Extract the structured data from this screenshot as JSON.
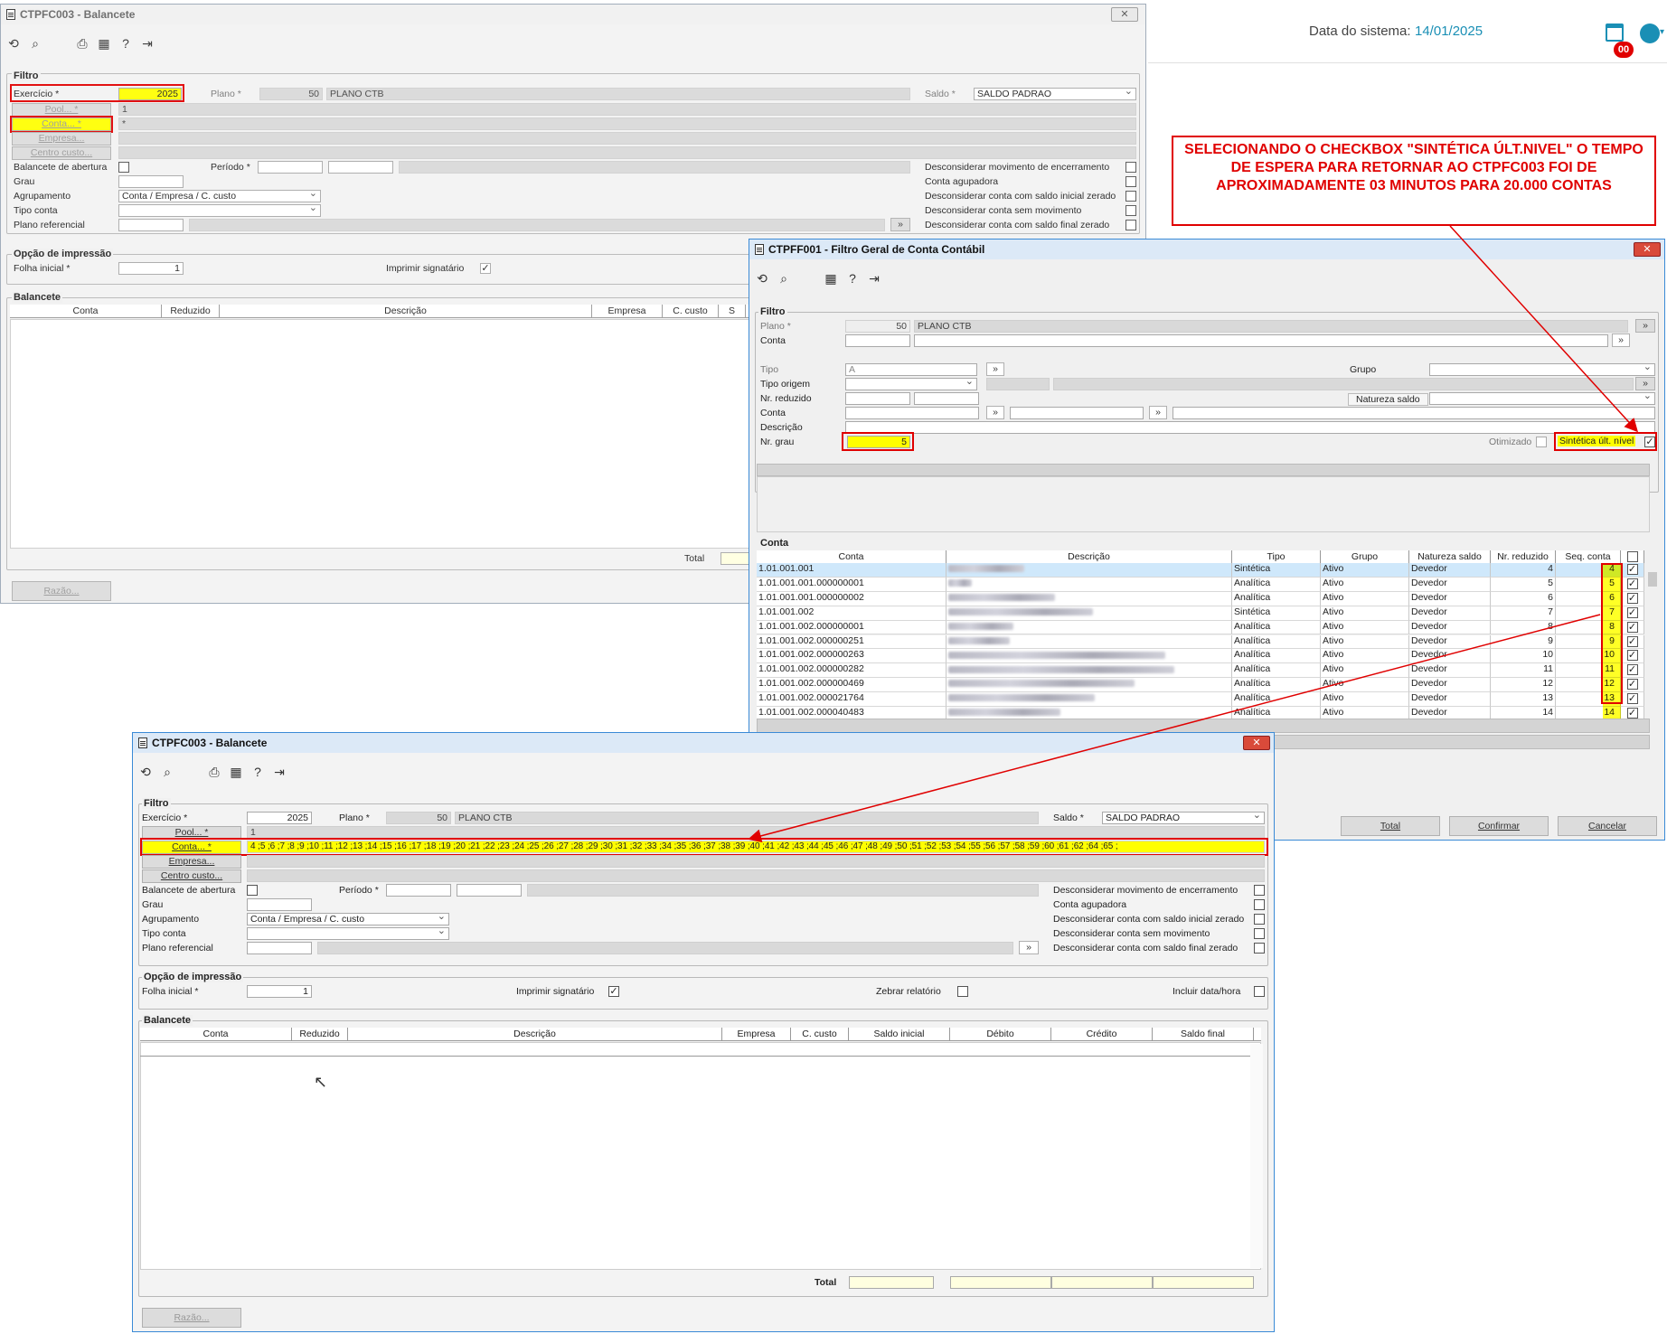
{
  "system_header": {
    "date_label": "Data do sistema:",
    "date_value": "14/01/2025",
    "badge": "00",
    "calendar_icon": "calendar-icon",
    "user_icon": "user-icon"
  },
  "note": {
    "text": "SELECIONANDO O CHECKBOX \"SINTÉTICA ÚLT.NIVEL\" O TEMPO DE ESPERA PARA RETORNAR AO CTPFC003 FOI DE APROXIMADAMENTE 03 MINUTOS PARA  20.000 CONTAS"
  },
  "win1": {
    "title": "CTPFC003 - Balancete",
    "filtro": "Filtro",
    "exercicio_label": "Exercício *",
    "exercicio_value": "2025",
    "plano_label": "Plano *",
    "plano_num": "50",
    "plano_desc": "PLANO CTB",
    "saldo_label": "Saldo *",
    "saldo_value": "SALDO PADRAO",
    "pool_label": "Pool... *",
    "pool_value": "1",
    "conta_label": "Conta... *",
    "conta_value": "*",
    "empresa_label": "Empresa...",
    "centro_label": "Centro custo...",
    "bal_abertura": "Balancete de abertura",
    "periodo_label": "Período *",
    "grau": "Grau",
    "agrupamento": "Agrupamento",
    "agrup_value": "Conta / Empresa / C. custo",
    "tipo_conta": "Tipo conta",
    "plano_ref": "Plano referencial",
    "opts": [
      "Desconsiderar movimento de encerramento",
      "Conta agupadora",
      "Desconsiderar conta com saldo inicial zerado",
      "Desconsiderar conta sem movimento",
      "Desconsiderar conta com saldo final zerado"
    ],
    "opcao": "Opção de impressão",
    "folha_label": "Folha inicial *",
    "folha_value": "1",
    "signatario": "Imprimir signatário",
    "balancete": "Balancete",
    "cols": [
      "Conta",
      "Reduzido",
      "Descrição",
      "Empresa",
      "C. custo",
      "S"
    ],
    "total": "Total",
    "razao": "Razão..."
  },
  "win2": {
    "title": "CTPFF001 - Filtro Geral de Conta Contábil",
    "filtro": "Filtro",
    "plano_label": "Plano *",
    "plano_num": "50",
    "plano_desc": "PLANO CTB",
    "conta_label": "Conta",
    "tipo_label": "Tipo",
    "tipo_value": "A",
    "grupo_label": "Grupo",
    "tipo_origem": "Tipo origem",
    "nr_reduzido": "Nr. reduzido",
    "natureza_label": "Natureza saldo",
    "conta2": "Conta",
    "descricao": "Descrição",
    "nr_grau": "Nr. grau",
    "nr_grau_value": "5",
    "otimizado": "Otimizado",
    "sintetica": "Sintética últ. nível",
    "conta_section": "Conta",
    "cols": [
      "Conta",
      "Descrição",
      "Tipo",
      "Grupo",
      "Natureza saldo",
      "Nr. reduzido",
      "Seq. conta"
    ],
    "rows": [
      {
        "conta": "1.01.001.001",
        "tipo": "Sintética",
        "grupo": "Ativo",
        "nat": "Devedor",
        "red": "4",
        "seq": "4",
        "w": 84
      },
      {
        "conta": "1.01.001.001.000000001",
        "tipo": "Analítica",
        "grupo": "Ativo",
        "nat": "Devedor",
        "red": "5",
        "seq": "5",
        "w": 26
      },
      {
        "conta": "1.01.001.001.000000002",
        "tipo": "Analítica",
        "grupo": "Ativo",
        "nat": "Devedor",
        "red": "6",
        "seq": "6",
        "w": 118
      },
      {
        "conta": "1.01.001.002",
        "tipo": "Sintética",
        "grupo": "Ativo",
        "nat": "Devedor",
        "red": "7",
        "seq": "7",
        "w": 160
      },
      {
        "conta": "1.01.001.002.000000001",
        "tipo": "Analítica",
        "grupo": "Ativo",
        "nat": "Devedor",
        "red": "8",
        "seq": "8",
        "w": 72
      },
      {
        "conta": "1.01.001.002.000000251",
        "tipo": "Analítica",
        "grupo": "Ativo",
        "nat": "Devedor",
        "red": "9",
        "seq": "9",
        "w": 68
      },
      {
        "conta": "1.01.001.002.000000263",
        "tipo": "Analítica",
        "grupo": "Ativo",
        "nat": "Devedor",
        "red": "10",
        "seq": "10",
        "w": 240
      },
      {
        "conta": "1.01.001.002.000000282",
        "tipo": "Analítica",
        "grupo": "Ativo",
        "nat": "Devedor",
        "red": "11",
        "seq": "11",
        "w": 250
      },
      {
        "conta": "1.01.001.002.000000469",
        "tipo": "Analítica",
        "grupo": "Ativo",
        "nat": "Devedor",
        "red": "12",
        "seq": "12",
        "w": 206
      },
      {
        "conta": "1.01.001.002.000021764",
        "tipo": "Analítica",
        "grupo": "Ativo",
        "nat": "Devedor",
        "red": "13",
        "seq": "13",
        "w": 162
      },
      {
        "conta": "1.01.001.002.000040483",
        "tipo": "Analítica",
        "grupo": "Ativo",
        "nat": "Devedor",
        "red": "14",
        "seq": "14",
        "w": 124
      }
    ],
    "total_btn": "Total",
    "confirmar_btn": "Confirmar",
    "cancelar_btn": "Cancelar"
  },
  "win3": {
    "title": "CTPFC003 - Balancete",
    "filtro": "Filtro",
    "exercicio_label": "Exercício *",
    "exercicio_value": "2025",
    "plano_label": "Plano *",
    "plano_num": "50",
    "plano_desc": "PLANO CTB",
    "saldo_label": "Saldo *",
    "saldo_value": "SALDO PADRAO",
    "pool_label": "Pool... *",
    "pool_value": "1",
    "conta_label": "Conta... *",
    "conta_value": "4 ;5 ;6 ;7 ;8 ;9 ;10 ;11 ;12 ;13 ;14 ;15 ;16 ;17 ;18 ;19 ;20 ;21 ;22 ;23 ;24 ;25 ;26 ;27 ;28 ;29 ;30 ;31 ;32 ;33 ;34 ;35 ;36 ;37 ;38 ;39 ;40 ;41 ;42 ;43 ;44 ;45 ;46 ;47 ;48 ;49 ;50 ;51 ;52 ;53 ;54 ;55 ;56 ;57 ;58 ;59 ;60 ;61 ;62 ;64 ;65 ;",
    "empresa_label": "Empresa...",
    "centro_label": "Centro custo...",
    "bal_abertura": "Balancete de abertura",
    "periodo_label": "Período *",
    "grau": "Grau",
    "agrupamento": "Agrupamento",
    "agrup_value": "Conta / Empresa / C. custo",
    "tipo_conta": "Tipo conta",
    "plano_ref": "Plano referencial",
    "opts": [
      "Desconsiderar movimento de encerramento",
      "Conta agupadora",
      "Desconsiderar conta com saldo inicial zerado",
      "Desconsiderar conta sem movimento",
      "Desconsiderar conta com saldo final zerado"
    ],
    "opcao": "Opção de impressão",
    "folha_label": "Folha inicial *",
    "folha_value": "1",
    "signatario": "Imprimir signatário",
    "zebrar": "Zebrar relatório",
    "incluir": "Incluir data/hora",
    "balancete": "Balancete",
    "cols": [
      "Conta",
      "Reduzido",
      "Descrição",
      "Empresa",
      "C. custo",
      "Saldo inicial",
      "Débito",
      "Crédito",
      "Saldo final"
    ],
    "total": "Total",
    "razao": "Razão..."
  }
}
